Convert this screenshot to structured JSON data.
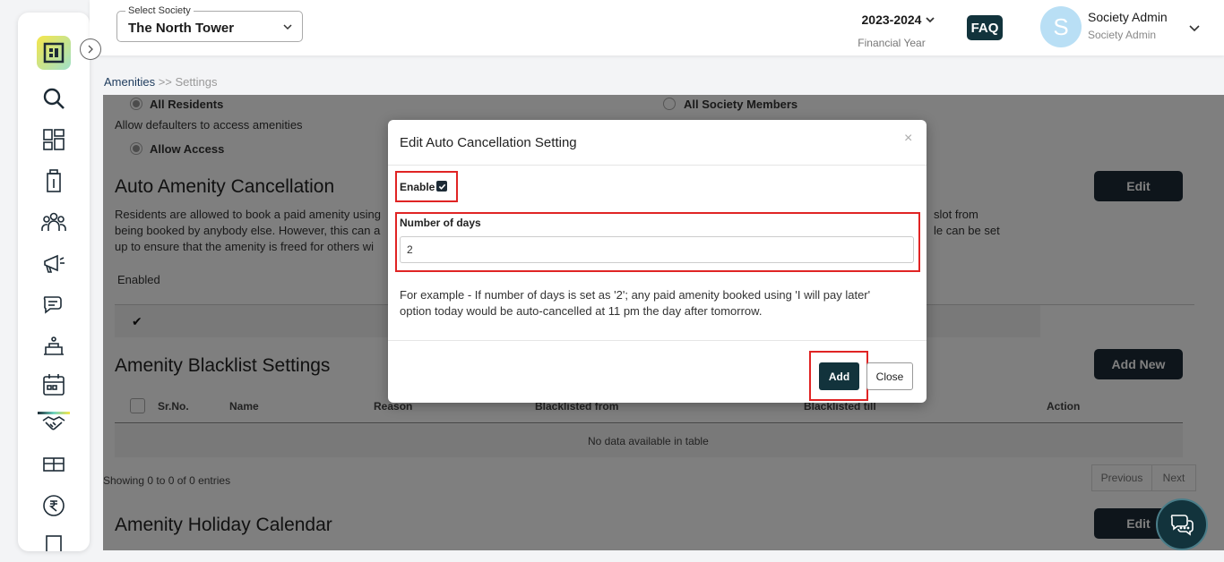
{
  "header": {
    "society_label": "Select Society",
    "society_value": "The North Tower",
    "financial_year": "2023-2024",
    "financial_year_label": "Financial Year",
    "faq": "FAQ",
    "avatar_letter": "S",
    "user_name": "Society Admin",
    "user_role": "Society Admin"
  },
  "sidebar": {
    "items": [
      "search-icon",
      "dashboard-icon",
      "building-icon",
      "members-icon",
      "announcement-icon",
      "chat-icon",
      "amenity-icon",
      "calendar-icon",
      "handshake-icon",
      "parcel-icon",
      "rupee-icon",
      "document-icon"
    ],
    "active": "calendar-icon"
  },
  "breadcrumb": {
    "link": "Amenities",
    "sep": ">>",
    "current": "Settings"
  },
  "content": {
    "radio_all_residents": "All Residents",
    "radio_all_members": "All Society Members",
    "defaulters_text": "Allow defaulters to access amenities",
    "radio_allow_access": "Allow Access",
    "auto_cancel_title": "Auto Amenity Cancellation",
    "auto_cancel_desc_1": "Residents are allowed to book a paid amenity using",
    "auto_cancel_desc_2": "being booked by anybody else. However, this can a",
    "auto_cancel_desc_3": "up to ensure that the amenity is freed for others wi",
    "auto_cancel_desc_right_1": "slot from",
    "auto_cancel_desc_right_2": "le can be set",
    "edit_label": "Edit",
    "enabled_col": "Enabled",
    "check_mark": "✔",
    "blacklist_title": "Amenity Blacklist Settings",
    "add_new_label": "Add New",
    "table_headers": [
      "Sr.No.",
      "Name",
      "Reason",
      "Blacklisted from",
      "Blacklisted till",
      "Action"
    ],
    "no_data": "No data available in table",
    "showing": "Showing 0 to 0 of 0 entries",
    "prev": "Previous",
    "next": "Next",
    "holiday_title": "Amenity Holiday Calendar",
    "edit_label_2": "Edit"
  },
  "modal": {
    "title": "Edit Auto Cancellation Setting",
    "close_x": "×",
    "enable_label": "Enable",
    "enable_checked": true,
    "days_label": "Number of days",
    "days_value": "2",
    "example": "For example - If number of days is set as '2'; any paid amenity booked using 'I will pay later' option today would be auto-cancelled at 11 pm the day after tomorrow.",
    "add_label": "Add",
    "close_label": "Close"
  },
  "colors": {
    "primary_dark": "#12333c",
    "highlight": "#e02424"
  }
}
